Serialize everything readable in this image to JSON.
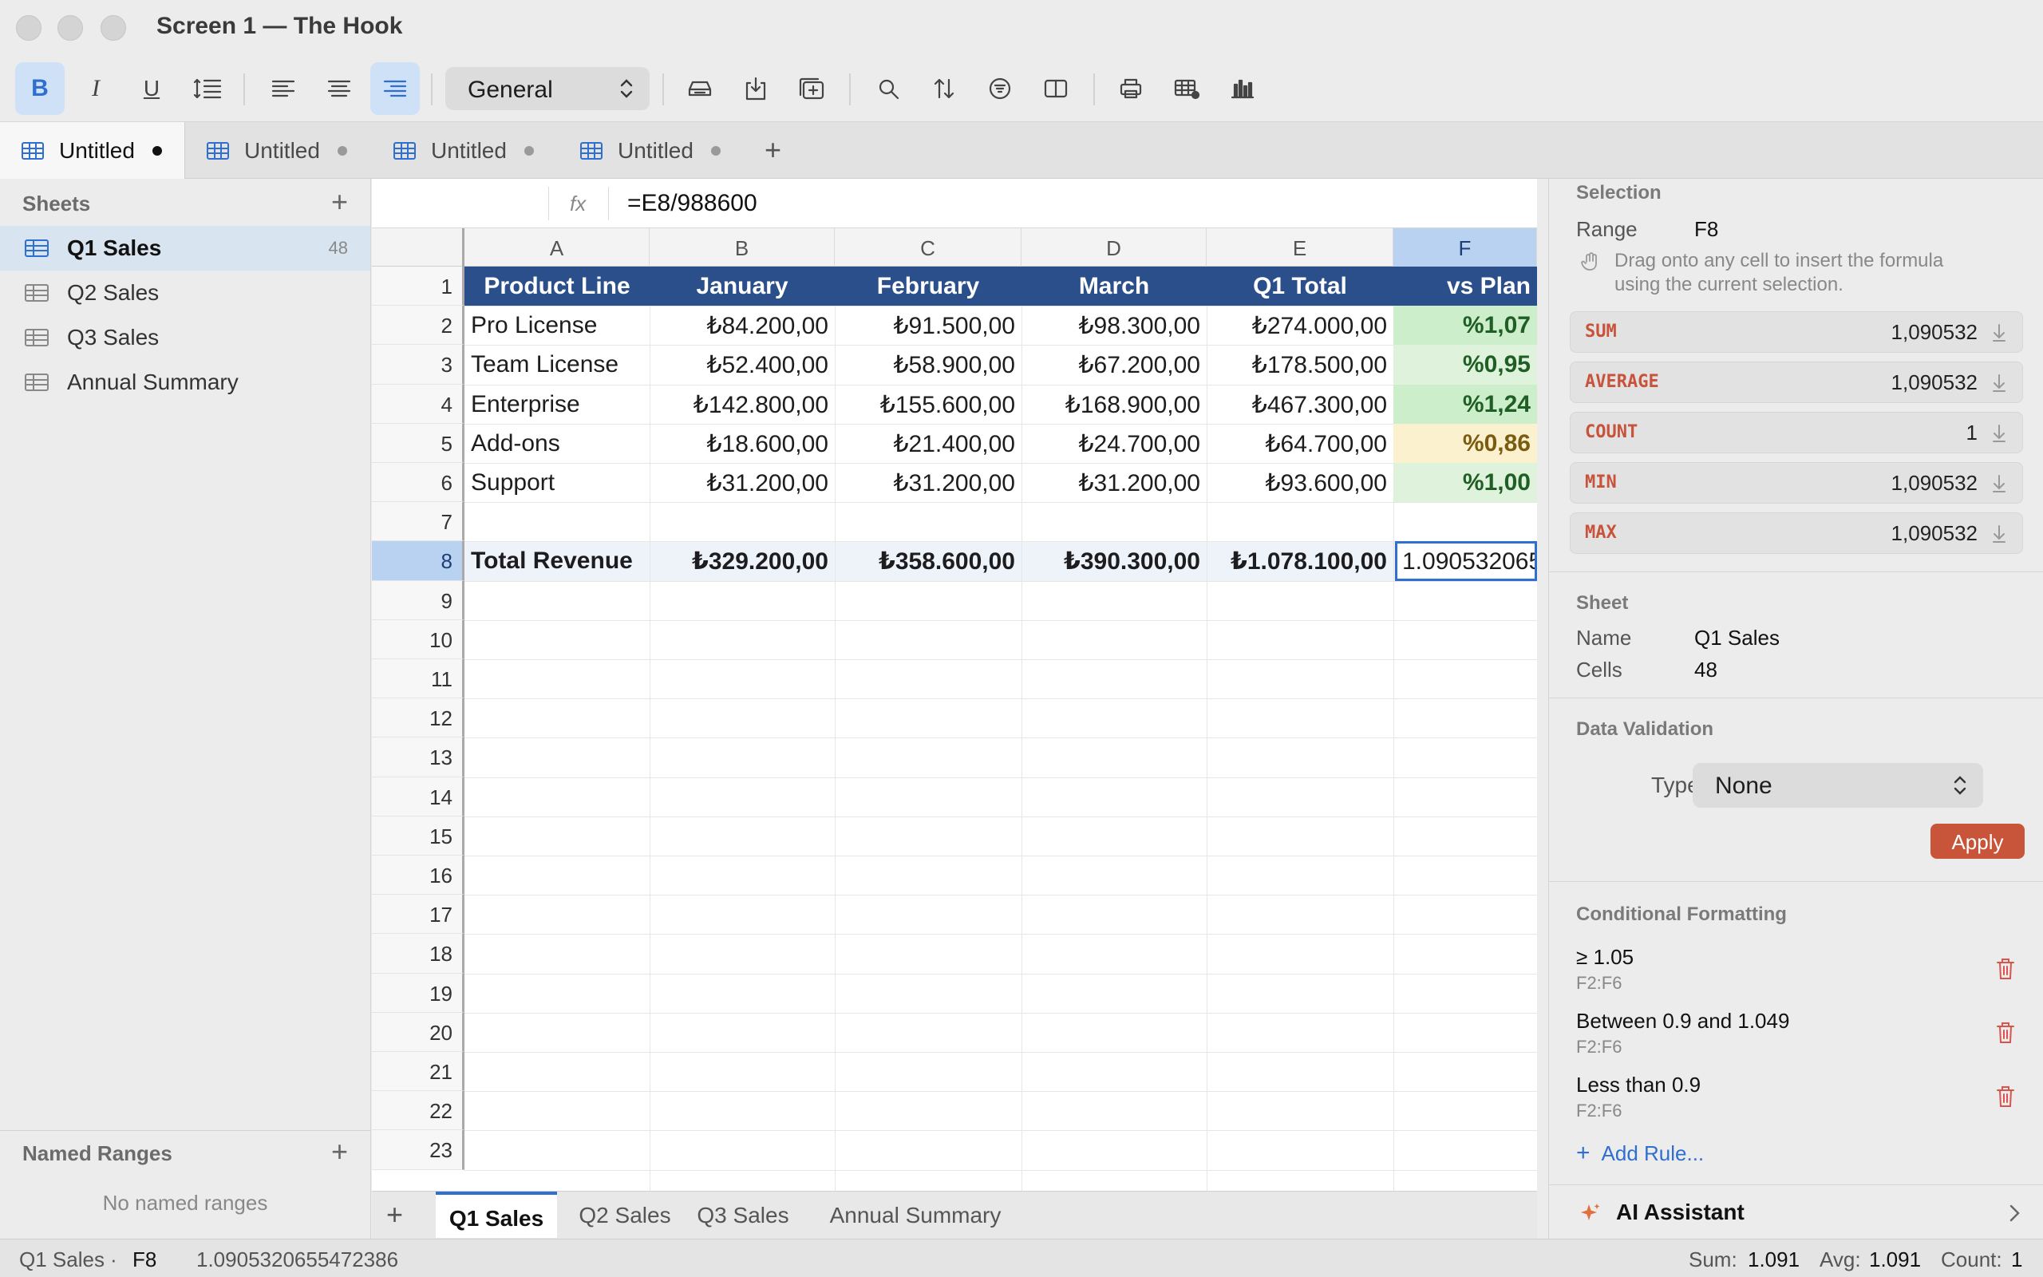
{
  "window": {
    "title": "Screen 1 — The Hook"
  },
  "toolbar": {
    "number_format": "General",
    "buttons": [
      "bold",
      "italic",
      "underline",
      "line-spacing",
      "align-left",
      "align-center",
      "align-right",
      "insert-row",
      "import",
      "insert-table",
      "find",
      "sort",
      "filter",
      "split-view",
      "print",
      "table-settings",
      "chart"
    ]
  },
  "doc_tabs": [
    {
      "label": "Untitled",
      "active": true
    },
    {
      "label": "Untitled",
      "active": false
    },
    {
      "label": "Untitled",
      "active": false
    },
    {
      "label": "Untitled",
      "active": false
    }
  ],
  "sidebar": {
    "sheets_header": "Sheets",
    "sheets": [
      {
        "label": "Q1 Sales",
        "count": "48",
        "selected": true
      },
      {
        "label": "Q2 Sales",
        "count": "",
        "selected": false
      },
      {
        "label": "Q3 Sales",
        "count": "",
        "selected": false
      },
      {
        "label": "Annual Summary",
        "count": "",
        "selected": false
      }
    ],
    "named_ranges_header": "Named Ranges",
    "named_ranges_empty": "No named ranges"
  },
  "formula_bar": {
    "fx": "fx",
    "formula": "=E8/988600"
  },
  "grid": {
    "columns": [
      "A",
      "B",
      "C",
      "D",
      "E",
      "F"
    ],
    "selected_column": "F",
    "selected_row": 8,
    "row_numbers": [
      "1",
      "2",
      "3",
      "4",
      "5",
      "6",
      "7",
      "8",
      "9",
      "10",
      "11",
      "12",
      "13",
      "14",
      "15",
      "16",
      "17",
      "18",
      "19",
      "20",
      "21",
      "22",
      "23"
    ],
    "header_row": [
      "Product Line",
      "January",
      "February",
      "March",
      "Q1 Total",
      "vs Plan"
    ],
    "rows": [
      [
        "Pro License",
        "₺84.200,00",
        "₺91.500,00",
        "₺98.300,00",
        "₺274.000,00",
        "%1,07"
      ],
      [
        "Team License",
        "₺52.400,00",
        "₺58.900,00",
        "₺67.200,00",
        "₺178.500,00",
        "%0,95"
      ],
      [
        "Enterprise",
        "₺142.800,00",
        "₺155.600,00",
        "₺168.900,00",
        "₺467.300,00",
        "%1,24"
      ],
      [
        "Add-ons",
        "₺18.600,00",
        "₺21.400,00",
        "₺24.700,00",
        "₺64.700,00",
        "%0,86"
      ],
      [
        "Support",
        "₺31.200,00",
        "₺31.200,00",
        "₺31.200,00",
        "₺93.600,00",
        "%1,00"
      ]
    ],
    "vs_plan_format": [
      "g1",
      "g2",
      "g1",
      "y1",
      "g2"
    ],
    "total_row": [
      "Total Revenue",
      "₺329.200,00",
      "₺358.600,00",
      "₺390.300,00",
      "₺1.078.100,00",
      "1.090532065"
    ]
  },
  "sheet_tabs": [
    "Q1 Sales",
    "Q2 Sales",
    "Q3 Sales",
    "Annual Summary"
  ],
  "inspector": {
    "selection_header": "Selection",
    "range_label": "Range",
    "range_value": "F8",
    "hint": "Drag onto any cell to insert the formula using the current selection.",
    "aggregates": [
      {
        "fn": "SUM",
        "value": "1,090532"
      },
      {
        "fn": "AVERAGE",
        "value": "1,090532"
      },
      {
        "fn": "COUNT",
        "value": "1"
      },
      {
        "fn": "MIN",
        "value": "1,090532"
      },
      {
        "fn": "MAX",
        "value": "1,090532"
      }
    ],
    "sheet_header": "Sheet",
    "name_label": "Name",
    "name_value": "Q1 Sales",
    "cells_label": "Cells",
    "cells_value": "48",
    "validation_header": "Data Validation",
    "type_label": "Type",
    "type_value": "None",
    "apply_label": "Apply",
    "cf_header": "Conditional Formatting",
    "rules": [
      {
        "title": "≥ 1.05",
        "range": "F2:F6"
      },
      {
        "title": "Between 0.9 and 1.049",
        "range": "F2:F6"
      },
      {
        "title": "Less than 0.9",
        "range": "F2:F6"
      }
    ],
    "add_rule": "Add Rule...",
    "ai_assistant": "AI Assistant"
  },
  "status_bar": {
    "sheet": "Q1 Sales",
    "sep": "·",
    "cell": "F8",
    "value": "1.0905320655472386",
    "sum_label": "Sum:",
    "sum": "1.091",
    "avg_label": "Avg:",
    "avg": "1.091",
    "count_label": "Count:",
    "count": "1"
  },
  "colors": {
    "accent": "#2f6fd0",
    "header_fill": "#2b4f8a",
    "apply": "#c8553a",
    "good": "#cdeecb",
    "warn": "#fcf1cf"
  }
}
